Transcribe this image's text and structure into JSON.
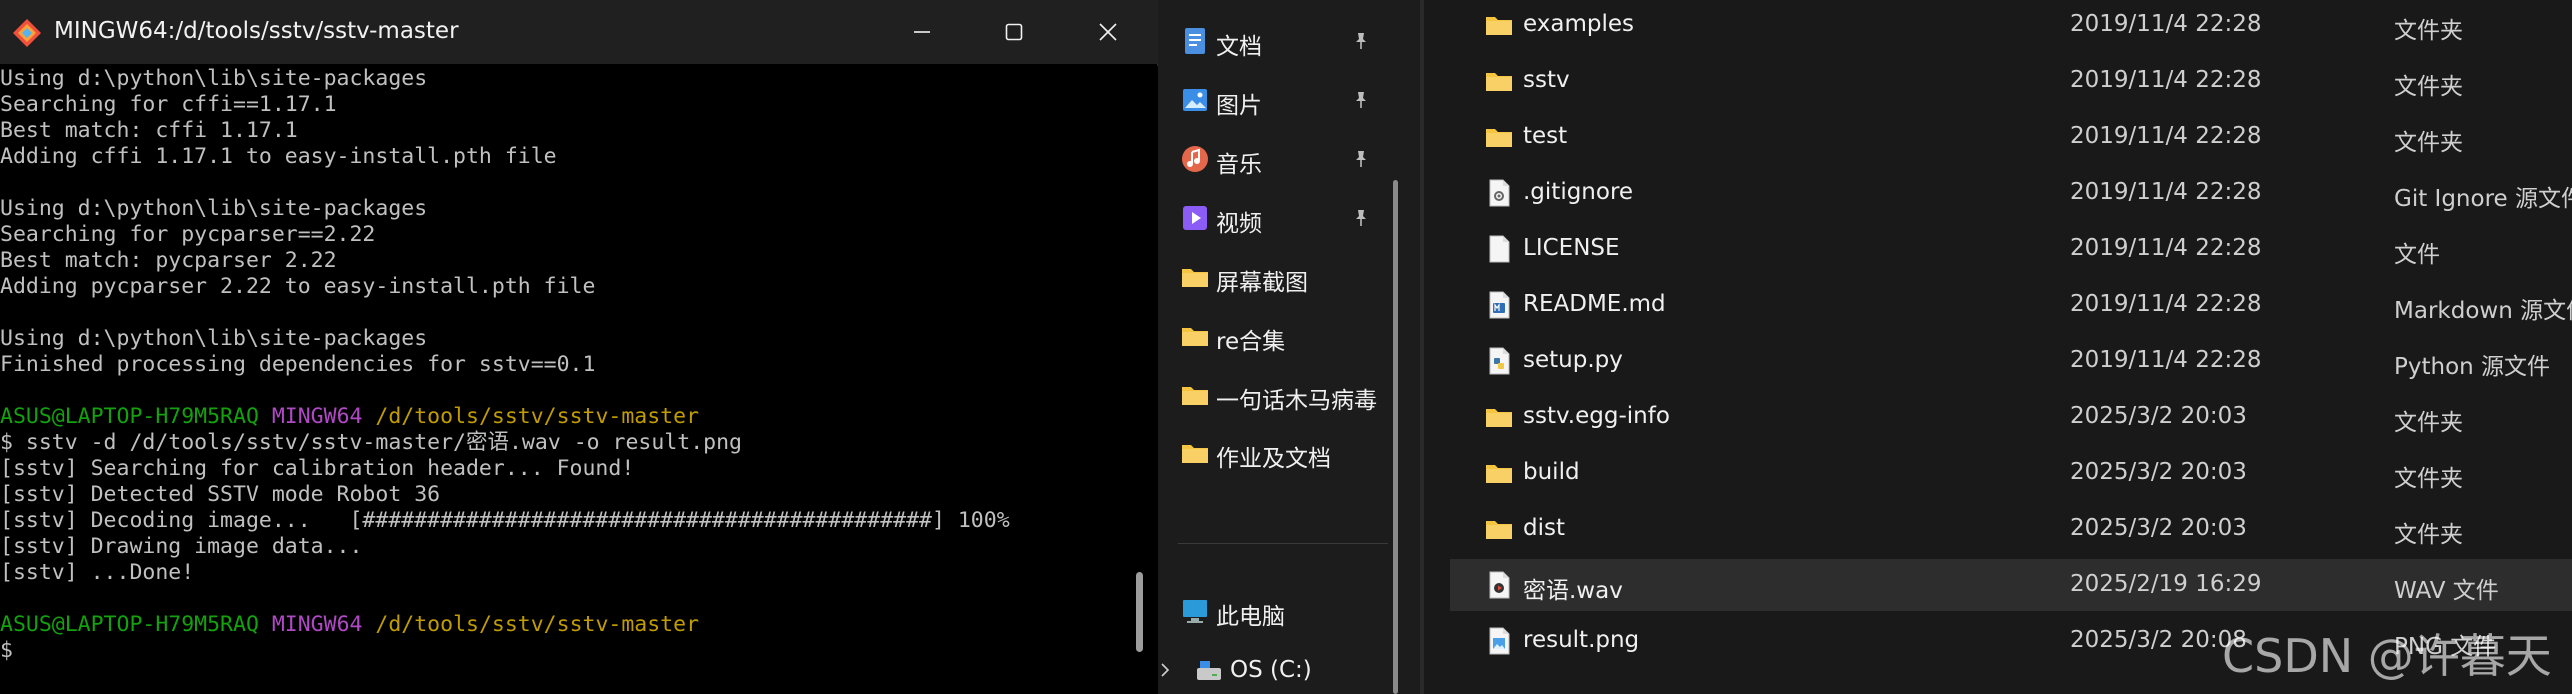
{
  "terminal": {
    "title": "MINGW64:/d/tools/sstv/sstv-master",
    "lines": [
      {
        "segments": [
          {
            "text": "Using d:\\python\\lib\\site-packages",
            "color": "default"
          }
        ]
      },
      {
        "segments": [
          {
            "text": "Searching for cffi==1.17.1",
            "color": "default"
          }
        ]
      },
      {
        "segments": [
          {
            "text": "Best match: cffi 1.17.1",
            "color": "default"
          }
        ]
      },
      {
        "segments": [
          {
            "text": "Adding cffi 1.17.1 to easy-install.pth file",
            "color": "default"
          }
        ]
      },
      {
        "segments": [
          {
            "text": "",
            "color": "default"
          }
        ]
      },
      {
        "segments": [
          {
            "text": "Using d:\\python\\lib\\site-packages",
            "color": "default"
          }
        ]
      },
      {
        "segments": [
          {
            "text": "Searching for pycparser==2.22",
            "color": "default"
          }
        ]
      },
      {
        "segments": [
          {
            "text": "Best match: pycparser 2.22",
            "color": "default"
          }
        ]
      },
      {
        "segments": [
          {
            "text": "Adding pycparser 2.22 to easy-install.pth file",
            "color": "default"
          }
        ]
      },
      {
        "segments": [
          {
            "text": "",
            "color": "default"
          }
        ]
      },
      {
        "segments": [
          {
            "text": "Using d:\\python\\lib\\site-packages",
            "color": "default"
          }
        ]
      },
      {
        "segments": [
          {
            "text": "Finished processing dependencies for sstv==0.1",
            "color": "default"
          }
        ]
      },
      {
        "segments": [
          {
            "text": "",
            "color": "default"
          }
        ]
      },
      {
        "segments": [
          {
            "text": "ASUS@LAPTOP-H79M5RAQ",
            "color": "green"
          },
          {
            "text": " ",
            "color": "default"
          },
          {
            "text": "MINGW64",
            "color": "magenta"
          },
          {
            "text": " ",
            "color": "default"
          },
          {
            "text": "/d/tools/sstv/sstv-master",
            "color": "yellow"
          }
        ]
      },
      {
        "segments": [
          {
            "text": "$ sstv -d /d/tools/sstv/sstv-master/密语.wav -o result.png",
            "color": "default"
          }
        ]
      },
      {
        "segments": [
          {
            "text": "[sstv] Searching for calibration header... Found!",
            "color": "default"
          }
        ]
      },
      {
        "segments": [
          {
            "text": "[sstv] Detected SSTV mode Robot 36",
            "color": "default"
          }
        ]
      },
      {
        "segments": [
          {
            "text": "[sstv] Decoding image...   [############################################] 100%",
            "color": "default"
          }
        ]
      },
      {
        "segments": [
          {
            "text": "[sstv] Drawing image data...",
            "color": "default"
          }
        ]
      },
      {
        "segments": [
          {
            "text": "[sstv] ...Done!",
            "color": "default"
          }
        ]
      },
      {
        "segments": [
          {
            "text": "",
            "color": "default"
          }
        ]
      },
      {
        "segments": [
          {
            "text": "ASUS@LAPTOP-H79M5RAQ",
            "color": "green"
          },
          {
            "text": " ",
            "color": "default"
          },
          {
            "text": "MINGW64",
            "color": "magenta"
          },
          {
            "text": " ",
            "color": "default"
          },
          {
            "text": "/d/tools/sstv/sstv-master",
            "color": "yellow"
          }
        ]
      },
      {
        "segments": [
          {
            "text": "$",
            "color": "default"
          }
        ]
      }
    ]
  },
  "nav": {
    "items": [
      {
        "label": "文档",
        "icon": "document-icon",
        "pinned": true
      },
      {
        "label": "图片",
        "icon": "pictures-icon",
        "pinned": true
      },
      {
        "label": "音乐",
        "icon": "music-icon",
        "pinned": true
      },
      {
        "label": "视频",
        "icon": "video-icon",
        "pinned": true
      },
      {
        "label": "屏幕截图",
        "icon": "folder-icon",
        "pinned": false
      },
      {
        "label": "re合集",
        "icon": "folder-icon",
        "pinned": false
      },
      {
        "label": "一句话木马病毒",
        "icon": "folder-icon",
        "pinned": false
      },
      {
        "label": "作业及文档",
        "icon": "folder-icon",
        "pinned": false
      },
      {
        "label": "此电脑",
        "icon": "this-pc-icon",
        "pinned": false
      },
      {
        "label": "OS (C:)",
        "icon": "drive-icon",
        "pinned": false
      }
    ]
  },
  "files": [
    {
      "name": "examples",
      "date": "2019/11/4 22:28",
      "type": "文件夹",
      "icon": "folder-icon",
      "selected": false
    },
    {
      "name": "sstv",
      "date": "2019/11/4 22:28",
      "type": "文件夹",
      "icon": "folder-icon",
      "selected": false
    },
    {
      "name": "test",
      "date": "2019/11/4 22:28",
      "type": "文件夹",
      "icon": "folder-icon",
      "selected": false
    },
    {
      "name": ".gitignore",
      "date": "2019/11/4 22:28",
      "type": "Git Ignore 源文件",
      "icon": "gitignore-file-icon",
      "selected": false
    },
    {
      "name": "LICENSE",
      "date": "2019/11/4 22:28",
      "type": "文件",
      "icon": "blank-file-icon",
      "selected": false
    },
    {
      "name": "README.md",
      "date": "2019/11/4 22:28",
      "type": "Markdown 源文件",
      "icon": "markdown-file-icon",
      "selected": false
    },
    {
      "name": "setup.py",
      "date": "2019/11/4 22:28",
      "type": "Python 源文件",
      "icon": "python-file-icon",
      "selected": false
    },
    {
      "name": "sstv.egg-info",
      "date": "2025/3/2 20:03",
      "type": "文件夹",
      "icon": "folder-icon",
      "selected": false
    },
    {
      "name": "build",
      "date": "2025/3/2 20:03",
      "type": "文件夹",
      "icon": "folder-icon",
      "selected": false
    },
    {
      "name": "dist",
      "date": "2025/3/2 20:03",
      "type": "文件夹",
      "icon": "folder-icon",
      "selected": false
    },
    {
      "name": "密语.wav",
      "date": "2025/2/19 16:29",
      "type": "WAV 文件",
      "icon": "wav-file-icon",
      "selected": true
    },
    {
      "name": "result.png",
      "date": "2025/3/2 20:08",
      "type": "PNG 文件",
      "icon": "png-file-icon",
      "selected": false
    }
  ],
  "watermark": "CSDN @许暮天",
  "colors": {
    "terminal_bg": "#000000",
    "terminal_text": "#c0c0c0",
    "prompt_user": "#13a10e",
    "prompt_shell": "#b148c6",
    "prompt_path": "#c19c00",
    "folder": "#f5c542",
    "explorer_bg": "#191919",
    "selected_row": "#2d2d2d"
  }
}
